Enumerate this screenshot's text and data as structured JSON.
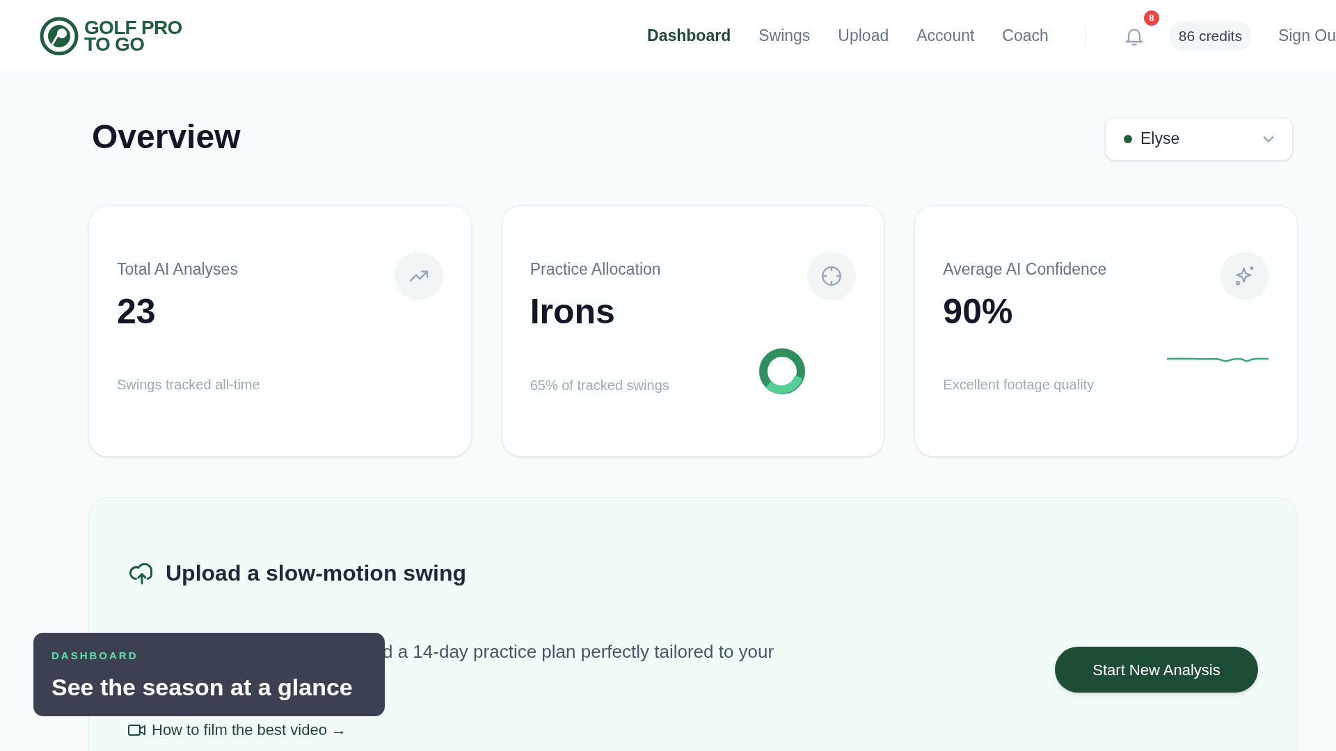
{
  "header": {
    "logo_text": [
      "GOLF PRO",
      "TO GO"
    ],
    "nav": [
      {
        "label": "Dashboard",
        "selected": true
      },
      {
        "label": "Swings",
        "selected": false
      },
      {
        "label": "Upload",
        "selected": false
      },
      {
        "label": "Account",
        "selected": false
      },
      {
        "label": "Coach",
        "selected": false
      }
    ],
    "notifications_badge": "8",
    "credits": "86 credits",
    "sign_out": "Sign Ou"
  },
  "page": {
    "title": "Overview",
    "player_select": {
      "value": "Elyse"
    }
  },
  "cards": [
    {
      "kind": "trend",
      "label": "Total AI Analyses",
      "value": "23",
      "caption": "Swings tracked all-time"
    },
    {
      "kind": "donut",
      "label": "Practice Allocation",
      "value": "Irons",
      "caption": "65% of tracked swings"
    },
    {
      "kind": "sparkline",
      "label": "Average AI Confidence",
      "value": "90%",
      "caption": "Excellent footage quality"
    }
  ],
  "upload": {
    "title": "Upload a slow-motion swing",
    "description": "d a 14-day practice plan perfectly tailored to your",
    "link": "How to film the best video →",
    "button": "Start New Analysis"
  },
  "caption_overlay": {
    "eyebrow": "DASHBOARD",
    "title": "See the season at a glance"
  }
}
